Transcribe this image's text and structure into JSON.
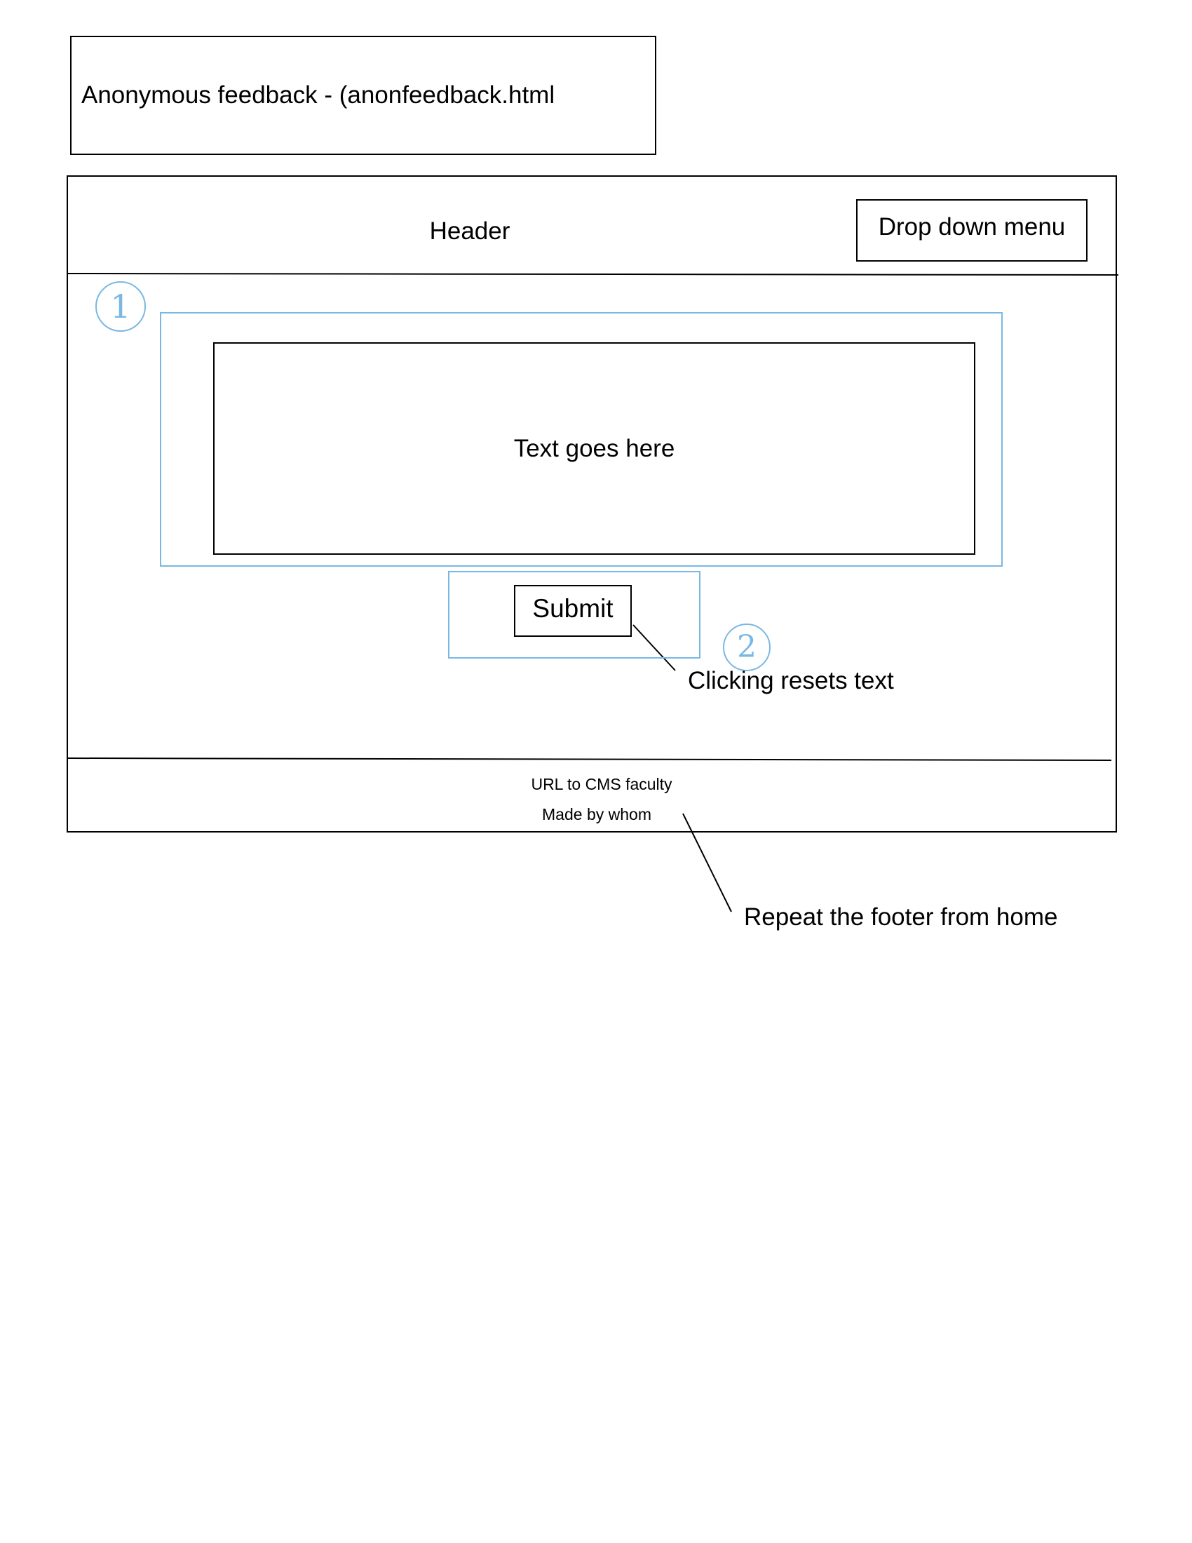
{
  "title_box": {
    "text": "Anonymous feedback - (anonfeedback.html"
  },
  "header": {
    "label": "Header",
    "dropdown_label": "Drop down menu"
  },
  "main": {
    "textarea_placeholder": "Text goes here",
    "submit_label": "Submit"
  },
  "annotations": {
    "callout_1": "1",
    "callout_2": "2",
    "submit_note": "Clicking resets text",
    "footer_note": "Repeat the footer from home"
  },
  "footer": {
    "url_text": "URL to CMS faculty",
    "made_by_text": "Made by whom"
  },
  "colors": {
    "annotation_blue": "#7ab8e3",
    "ink": "#000000"
  }
}
